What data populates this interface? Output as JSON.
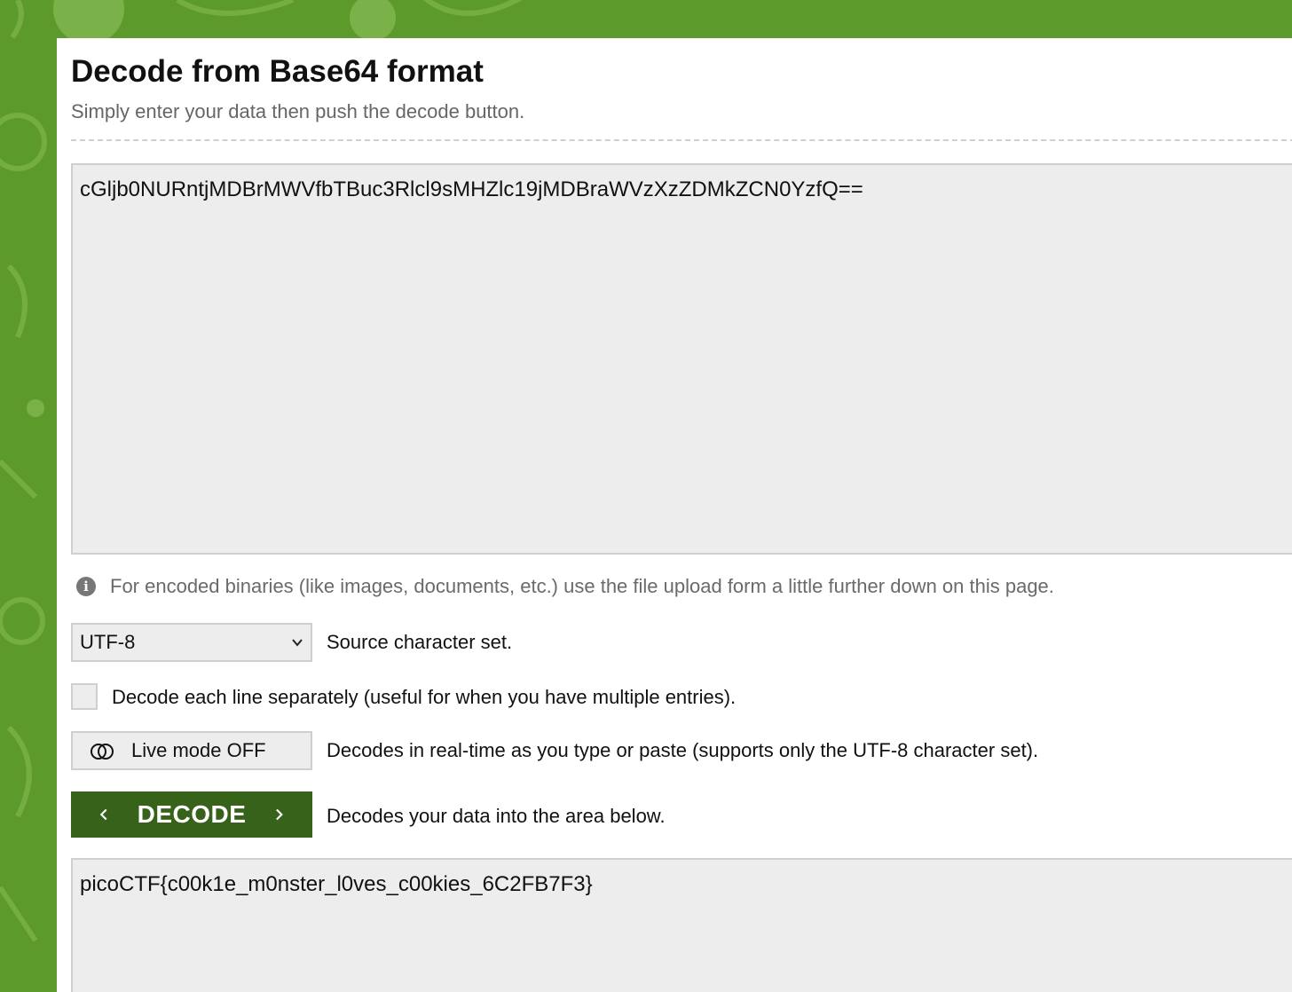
{
  "header": {
    "title": "Decode from Base64 format",
    "subtitle": "Simply enter your data then push the decode button."
  },
  "input": {
    "value": "cGljb0NURntjMDBrMWVfbTBuc3Rlcl9sMHZlc19jMDBraWVzXzZDMkZCN0YzfQ=="
  },
  "info": {
    "icon": "info-icon",
    "text": "For encoded binaries (like images, documents, etc.) use the file upload form a little further down on this page."
  },
  "charset": {
    "selected": "UTF-8",
    "label": "Source character set."
  },
  "line_option": {
    "checked": false,
    "label": "Decode each line separately (useful for when you have multiple entries)."
  },
  "live_mode": {
    "button_label": "Live mode OFF",
    "label": "Decodes in real-time as you type or paste (supports only the UTF-8 character set)."
  },
  "decode": {
    "button_label": "DECODE",
    "label": "Decodes your data into the area below."
  },
  "output": {
    "value": "picoCTF{c00k1e_m0nster_l0ves_c00kies_6C2FB7F3}"
  },
  "colors": {
    "brand_green": "#5c9b2b",
    "button_dark_green": "#36621a",
    "field_bg": "#ededed",
    "field_border": "#cfcfcf"
  }
}
